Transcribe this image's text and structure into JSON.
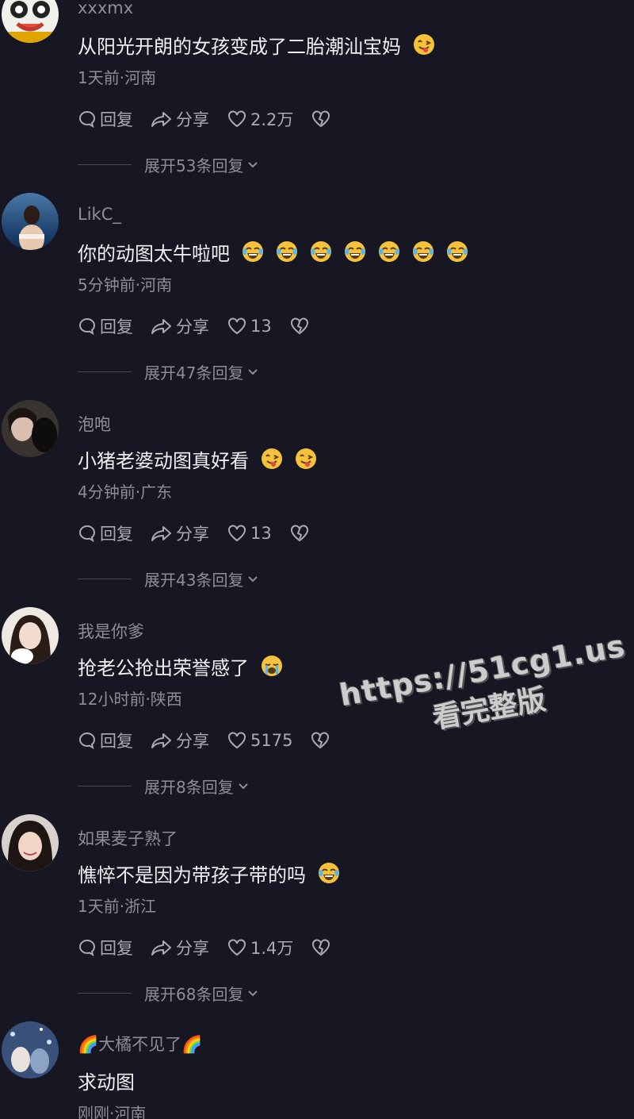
{
  "comments": [
    {
      "username": "xxxmx",
      "text": "从阳光开朗的女孩变成了二胎潮汕宝妈",
      "emojis": [
        "wink-tongue"
      ],
      "meta": "1天前·河南",
      "reply_label": "回复",
      "share_label": "分享",
      "likes": "2.2万",
      "expand_label": "展开53条回复"
    },
    {
      "username": "LikC_",
      "text": "你的动图太牛啦吧",
      "emojis": [
        "laugh-cry",
        "laugh-cry",
        "laugh-cry",
        "laugh-cry",
        "laugh-cry",
        "laugh-cry",
        "laugh-cry"
      ],
      "meta": "5分钟前·河南",
      "reply_label": "回复",
      "share_label": "分享",
      "likes": "13",
      "expand_label": "展开47条回复"
    },
    {
      "username": "泡咆",
      "text": "小猪老婆动图真好看",
      "emojis": [
        "wink-tongue",
        "wink-tongue"
      ],
      "meta": "4分钟前·广东",
      "reply_label": "回复",
      "share_label": "分享",
      "likes": "13",
      "expand_label": "展开43条回复"
    },
    {
      "username": "我是你爹",
      "text": "抢老公抢出荣誉感了",
      "emojis": [
        "crying"
      ],
      "meta": "12小时前·陕西",
      "reply_label": "回复",
      "share_label": "分享",
      "likes": "5175",
      "expand_label": "展开8条回复"
    },
    {
      "username": "如果麦子熟了",
      "text": "憔悴不是因为带孩子带的吗",
      "emojis": [
        "laugh-cry"
      ],
      "meta": "1天前·浙江",
      "reply_label": "回复",
      "share_label": "分享",
      "likes": "1.4万",
      "expand_label": "展开68条回复"
    },
    {
      "username": "🌈大橘不见了🌈",
      "text": "求动图",
      "emojis": [],
      "meta": "刚刚·河南"
    }
  ],
  "watermark": {
    "url": "https://51cg1.us",
    "subtitle": "看完整版"
  },
  "colors": {
    "background": "#161722",
    "text": "#f1f1f4",
    "muted": "#8d8e98",
    "emoji_face": "#f7c23b"
  }
}
